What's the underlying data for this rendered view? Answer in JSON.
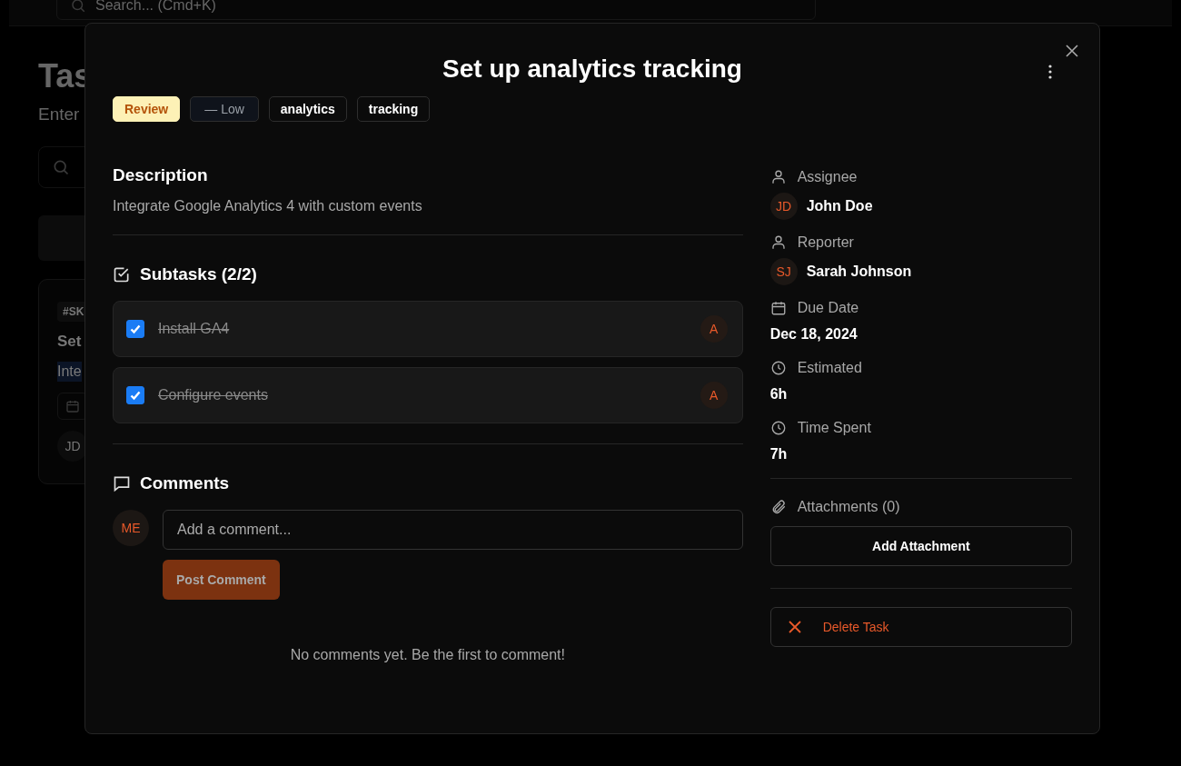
{
  "background": {
    "search": {
      "placeholder": "Search... (Cmd+K)"
    },
    "title": "Tas",
    "subtitle": "Enter",
    "card": {
      "tag": "#SK",
      "title": "Set",
      "description": "Inte",
      "avatar": "JD"
    }
  },
  "task": {
    "title": "Set up analytics tracking",
    "tags": [
      {
        "label": "Review",
        "kind": "status"
      },
      {
        "label": "— Low",
        "kind": "priority"
      },
      {
        "label": "analytics",
        "kind": "label"
      },
      {
        "label": "tracking",
        "kind": "label"
      }
    ],
    "description": {
      "heading": "Description",
      "text": "Integrate Google Analytics 4 with custom events"
    },
    "subtasks": {
      "heading": "Subtasks (2/2)",
      "items": [
        {
          "title": "Install GA4",
          "checked": true,
          "avatar": "A"
        },
        {
          "title": "Configure events",
          "checked": true,
          "avatar": "A"
        }
      ]
    },
    "comments": {
      "heading": "Comments",
      "avatar": "ME",
      "input": {
        "placeholder": "Add a comment..."
      },
      "post_button": {
        "label": "Post Comment",
        "disabled": true
      },
      "empty": "No comments yet. Be the first to comment!"
    },
    "details": [
      {
        "label": "Assignee",
        "kind": "person",
        "avatar": "JD",
        "value": "John Doe"
      },
      {
        "label": "Reporter",
        "kind": "person",
        "avatar": "SJ",
        "value": "Sarah Johnson"
      },
      {
        "label": "Due Date",
        "kind": "date",
        "value": "Dec 18, 2024"
      },
      {
        "label": "Estimated",
        "kind": "time",
        "value": "6h"
      },
      {
        "label": "Time Spent",
        "kind": "time",
        "value": "7h"
      }
    ],
    "attachments": {
      "label": "Attachments (0)",
      "button": "Add Attachment"
    },
    "delete_button": "Delete Task"
  }
}
